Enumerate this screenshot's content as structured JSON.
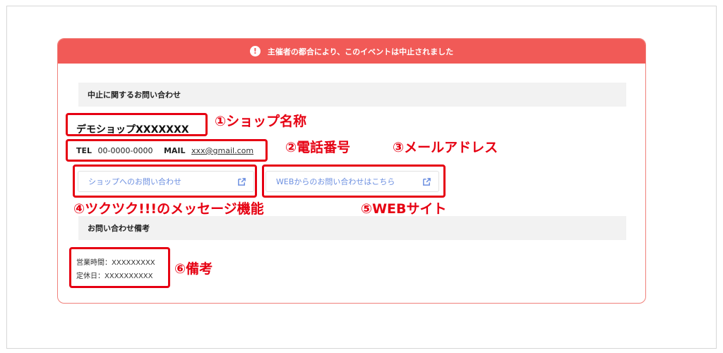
{
  "banner": {
    "icon": "!",
    "message": "主催者の都合により、このイベントは中止されました"
  },
  "inquiry_section": {
    "title": "中止に関するお問い合わせ"
  },
  "shop": {
    "name": "デモショップXXXXXXX"
  },
  "contact": {
    "tel_label": "TEL",
    "tel_value": "00-0000-0000",
    "mail_label": "MAIL",
    "mail_value": "xxx@gmail.com"
  },
  "buttons": {
    "shop_inquiry": "ショップへのお問い合わせ",
    "web_inquiry": "WEBからのお問い合わせはこちら"
  },
  "notes_section": {
    "title": "お問い合わせ備考"
  },
  "notes": {
    "hours": "営業時間：XXXXXXXXX",
    "holiday": "定休日：XXXXXXXXXX"
  },
  "annotations": {
    "a1": "①ショップ名称",
    "a2": "②電話番号",
    "a3": "③メールアドレス",
    "a4": "④ツクツク!!!のメッセージ機能",
    "a5": "⑤WEBサイト",
    "a6": "⑥備考"
  },
  "colors": {
    "accent": "#f15a57",
    "annotation": "#e60012",
    "link": "#6c8fe0"
  }
}
